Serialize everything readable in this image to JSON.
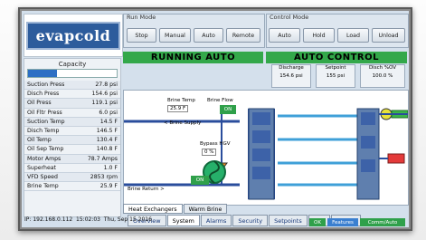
{
  "brand": {
    "logo_text": "evapcold",
    "logo_color": "#2d5c9c"
  },
  "capacity": {
    "title": "Capacity",
    "value_text": "33%",
    "fraction": 0.33
  },
  "readings": [
    {
      "label": "Suction Press",
      "value": "27.8 psi"
    },
    {
      "label": "Disch Press",
      "value": "154.6 psi"
    },
    {
      "label": "Oil Press",
      "value": "119.1 psi"
    },
    {
      "label": "Oil Fltr Press",
      "value": "6.0 psi"
    },
    {
      "label": "Suction Temp",
      "value": "14.5 F"
    },
    {
      "label": "Disch Temp",
      "value": "146.5 F"
    },
    {
      "label": "Oil Temp",
      "value": "130.4 F"
    },
    {
      "label": "Oil Sep Temp",
      "value": "140.8 F"
    },
    {
      "label": "Motor Amps",
      "value": "78.7 Amps"
    },
    {
      "label": "Superheat",
      "value": "1.0 F"
    },
    {
      "label": "VFD Speed",
      "value": "2853 rpm"
    },
    {
      "label": "Brine Temp",
      "value": "25.9 F"
    }
  ],
  "run_mode": {
    "label": "Run Mode",
    "buttons": [
      "Stop",
      "Manual",
      "Auto",
      "Remote"
    ],
    "status": "RUNNING AUTO"
  },
  "control_mode": {
    "label": "Control Mode",
    "buttons": [
      "Auto",
      "Hold",
      "Load",
      "Unload"
    ],
    "status": "AUTO CONTROL"
  },
  "setpoints": [
    {
      "label": "Discharge",
      "value": "154.6 psi"
    },
    {
      "label": "Setpoint",
      "value": "155 psi"
    },
    {
      "label": "Disch %OV",
      "value": "100.0 %"
    }
  ],
  "diagram": {
    "brine_in_label": "Brine Temp",
    "brine_in_value": "25.9 F",
    "brine_flow_label": "Brine Flow",
    "brine_flow_state": "ON",
    "brine_supply": "< Brine Supply",
    "bypass_label": "Bypass HGV",
    "bypass_value": "0 %",
    "pump_state": "ON",
    "brine_return": "Brine Return >"
  },
  "subtabs": [
    "Heat Exchangers",
    "Warm Brine"
  ],
  "tabs": [
    "Overview",
    "System",
    "Alarms",
    "Security",
    "Setpoints",
    "Info",
    "Config"
  ],
  "status": {
    "ip": "IP: 192.168.0.112",
    "time": "15:02:03",
    "date": "Thu, Sep 15 2016",
    "indicator1": "OK",
    "indicator2": "Features",
    "indicator3": "Comm/Auto"
  }
}
